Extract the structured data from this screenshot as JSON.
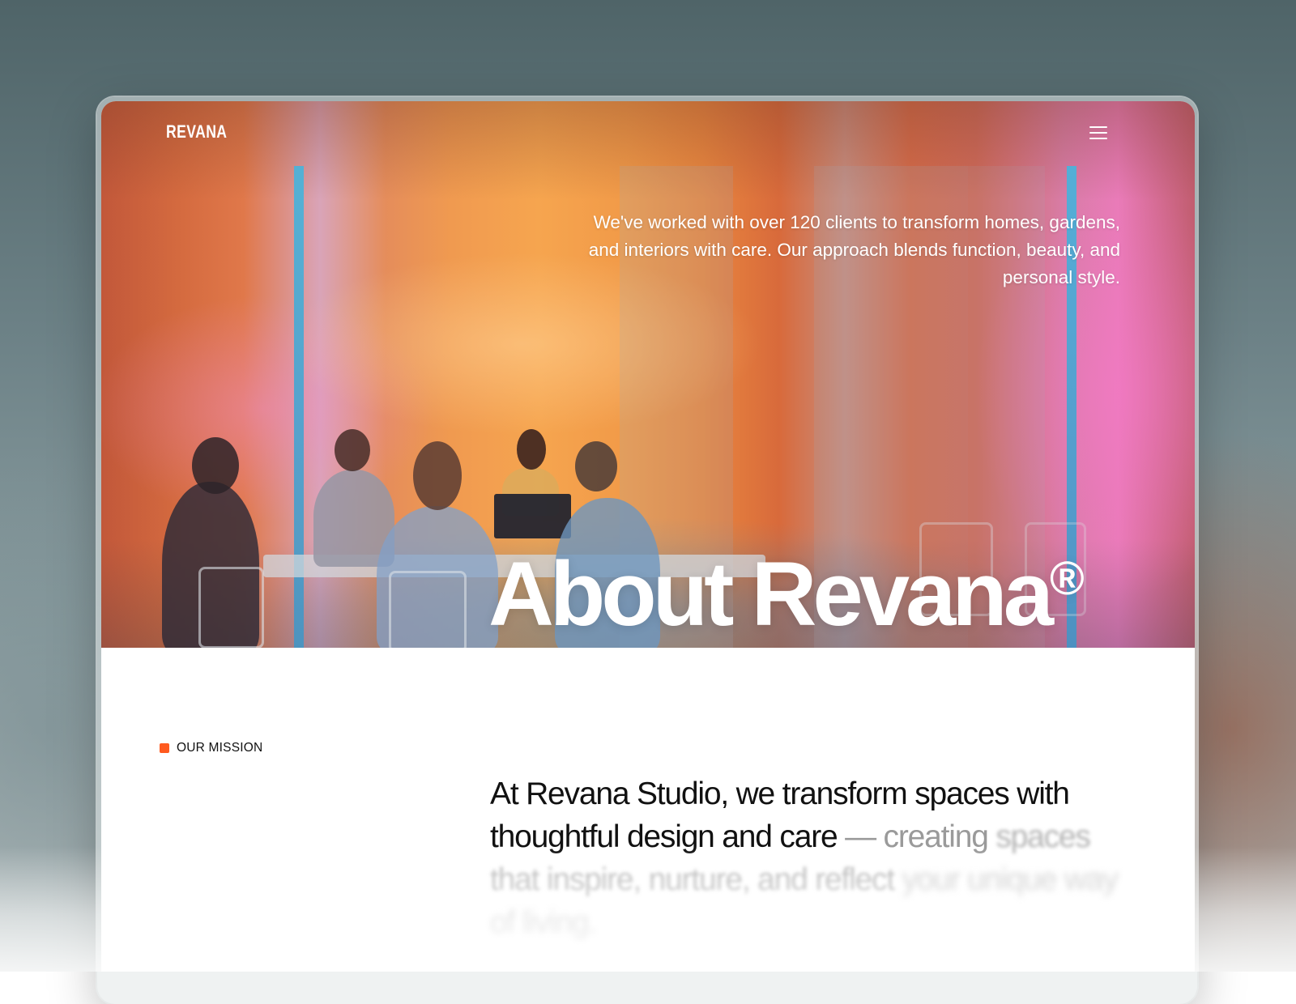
{
  "header": {
    "brand": "REVANA",
    "menu_icon": "hamburger-menu-icon"
  },
  "hero": {
    "intro_text": "We've worked with over 120 clients to transform homes, gardens, and interiors with care. Our approach blends function, beauty, and personal style.",
    "title": "About Revana",
    "title_mark": "®"
  },
  "mission": {
    "label": "OUR MISSION",
    "statement_strong": "At Revana Studio, we transform spaces with thoughtful design and care",
    "statement_dash": " — creating",
    "statement_fade_1": " spaces that inspire, nurture, and reflect",
    "statement_fade_2": " your unique way of living."
  },
  "colors": {
    "accent": "#ff5a1f",
    "text_dark": "#111111",
    "text_muted": "#9a9a9a"
  }
}
